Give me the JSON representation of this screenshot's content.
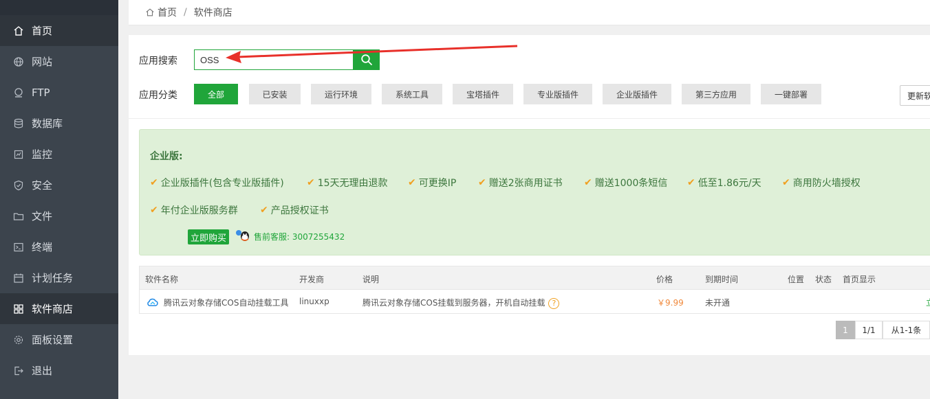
{
  "sidebar": {
    "top_text": "",
    "badge": "",
    "items": [
      {
        "label": "首页",
        "icon": "home-icon"
      },
      {
        "label": "网站",
        "icon": "globe-icon"
      },
      {
        "label": "FTP",
        "icon": "ftp-icon"
      },
      {
        "label": "数据库",
        "icon": "database-icon"
      },
      {
        "label": "监控",
        "icon": "monitor-icon"
      },
      {
        "label": "安全",
        "icon": "shield-icon"
      },
      {
        "label": "文件",
        "icon": "folder-icon"
      },
      {
        "label": "终端",
        "icon": "terminal-icon"
      },
      {
        "label": "计划任务",
        "icon": "calendar-icon"
      },
      {
        "label": "软件商店",
        "icon": "grid-icon"
      },
      {
        "label": "面板设置",
        "icon": "gear-icon"
      },
      {
        "label": "退出",
        "icon": "logout-icon"
      }
    ],
    "active_index": 9
  },
  "breadcrumb": {
    "home": "首页",
    "separator": "/",
    "current": "软件商店"
  },
  "search": {
    "label": "应用搜索",
    "value": "OSS"
  },
  "categories": {
    "label": "应用分类",
    "items": [
      "全部",
      "已安装",
      "运行环境",
      "系统工具",
      "宝塔插件",
      "专业版插件",
      "企业版插件",
      "第三方应用",
      "一键部署"
    ],
    "active_index": 0,
    "update_label": "更新软件列表"
  },
  "promo": {
    "title": "企业版:",
    "features": [
      "企业版插件(包含专业版插件)",
      "15天无理由退款",
      "可更换IP",
      "赠送2张商用证书",
      "赠送1000条短信",
      "低至1.86元/天",
      "商用防火墙授权",
      "年付企业版服务群",
      "产品授权证书"
    ],
    "buy_label": "立即购买",
    "support": "售前客服: 3007255432"
  },
  "table": {
    "headers": [
      "软件名称",
      "开发商",
      "说明",
      "价格",
      "到期时间",
      "位置",
      "状态",
      "首页显示"
    ],
    "rows": [
      {
        "name": "腾讯云对象存储COS自动挂载工具",
        "developer": "linuxxp",
        "description": "腾讯云对象存储COS挂载到服务器，开机自动挂载",
        "price": "￥9.99",
        "expiry": "未开通",
        "action": "立"
      }
    ]
  },
  "pagination": {
    "current": "1",
    "pages": "1/1",
    "range": "从1-1条"
  },
  "colors": {
    "accent": "#20a53a",
    "sidebar_bg": "#3c444d",
    "promo_bg": "#dff0d8",
    "warning": "#f0a020",
    "arrow": "#e8302a"
  }
}
